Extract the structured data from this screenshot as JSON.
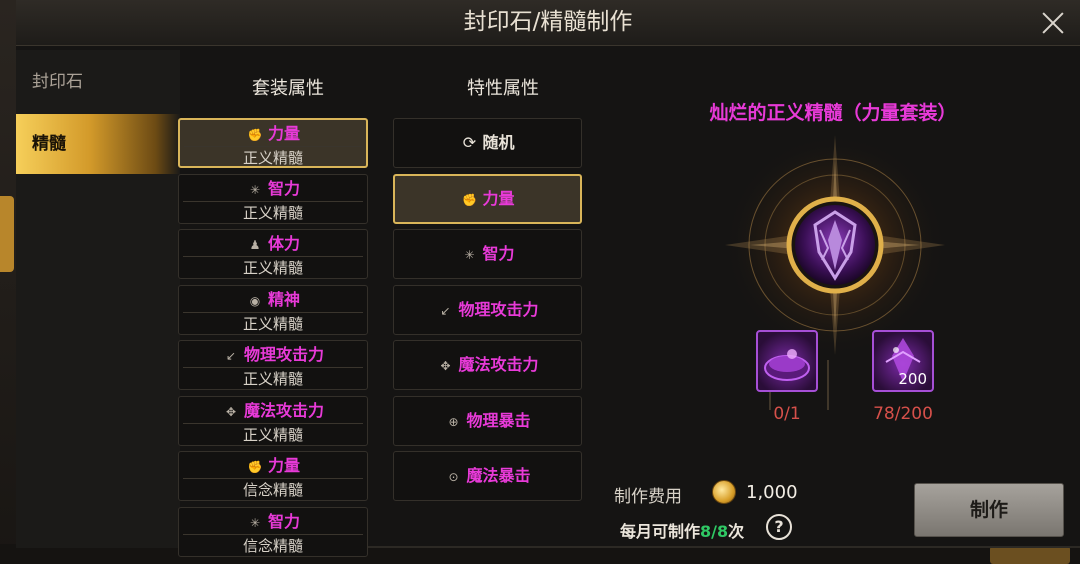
{
  "dialog": {
    "title": "封印石/精髓制作",
    "close_icon": "close-icon"
  },
  "sidebar": {
    "items": [
      {
        "label": "封印石"
      },
      {
        "label": "精髓"
      }
    ],
    "selected": 1
  },
  "set_column": {
    "header": "套装属性",
    "items": [
      {
        "icon": "fist-icon",
        "name": "力量",
        "type": "正义精髓"
      },
      {
        "icon": "sparkle-cross-icon",
        "name": "智力",
        "type": "正义精髓"
      },
      {
        "icon": "figure-icon",
        "name": "体力",
        "type": "正义精髓"
      },
      {
        "icon": "eye-icon",
        "name": "精神",
        "type": "正义精髓"
      },
      {
        "icon": "sword-icon",
        "name": "物理攻击力",
        "type": "正义精髓"
      },
      {
        "icon": "magic-star-icon",
        "name": "魔法攻击力",
        "type": "正义精髓"
      },
      {
        "icon": "fist-icon",
        "name": "力量",
        "type": "信念精髓"
      },
      {
        "icon": "sparkle-cross-icon",
        "name": "智力",
        "type": "信念精髓"
      }
    ],
    "selected": 0
  },
  "trait_column": {
    "header": "特性属性",
    "items": [
      {
        "icon": "refresh-icon",
        "label": "随机"
      },
      {
        "icon": "fist-icon",
        "label": "力量"
      },
      {
        "icon": "sparkle-cross-icon",
        "label": "智力"
      },
      {
        "icon": "sword-icon",
        "label": "物理攻击力"
      },
      {
        "icon": "magic-star-icon",
        "label": "魔法攻击力"
      },
      {
        "icon": "target-icon",
        "label": "物理暴击"
      },
      {
        "icon": "target-dot-icon",
        "label": "魔法暴击"
      }
    ],
    "selected": 1
  },
  "preview": {
    "title": "灿烂的正义精髓（力量套装）",
    "materials": [
      {
        "icon": "purple-bowl-icon",
        "count": "0/1",
        "badge": ""
      },
      {
        "icon": "purple-crystal-icon",
        "count": "78/200",
        "badge": "200"
      }
    ]
  },
  "footer": {
    "cost_label": "制作费用",
    "cost_value": "1,000",
    "monthly_prefix": "每月可制作",
    "monthly_count": "8/8",
    "monthly_suffix": "次",
    "help": "?",
    "make_button": "制作"
  },
  "colors": {
    "accent": "#e83ad8",
    "gold": "#d9b559",
    "highlight_green": "#2fc864",
    "count_red": "#d6504a"
  }
}
